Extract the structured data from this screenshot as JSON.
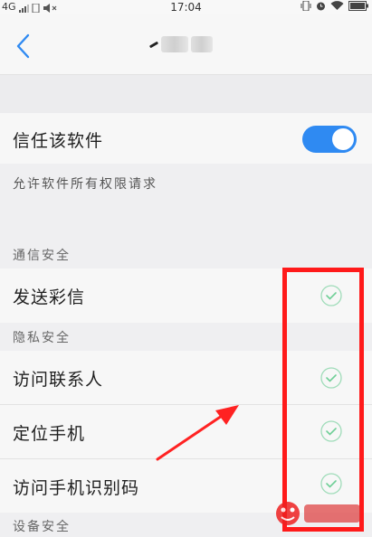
{
  "status_bar": {
    "network": "4G",
    "time": "17:04"
  },
  "header": {
    "back_label": "<"
  },
  "trust": {
    "label": "信任该软件",
    "toggle_on": true,
    "description": "允许软件所有权限请求"
  },
  "sections": [
    {
      "title": "通信安全",
      "items": [
        {
          "label": "发送彩信",
          "checked": true
        }
      ]
    },
    {
      "title": "隐私安全",
      "items": [
        {
          "label": "访问联系人",
          "checked": true
        },
        {
          "label": "定位手机",
          "checked": true
        },
        {
          "label": "访问手机识别码",
          "checked": true
        }
      ]
    },
    {
      "title": "设备安全",
      "items": []
    }
  ],
  "colors": {
    "toggle_on": "#2f8af2",
    "check_green": "#6fcf97",
    "annotation_red": "#ff1a1a"
  }
}
